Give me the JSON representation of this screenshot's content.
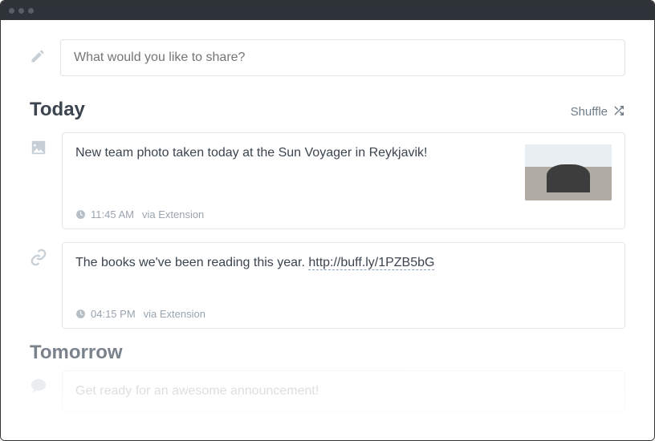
{
  "composer": {
    "placeholder": "What would you like to share?"
  },
  "shuffle_label": "Shuffle",
  "sections": {
    "today": {
      "title": "Today"
    },
    "tomorrow": {
      "title": "Tomorrow"
    }
  },
  "posts": {
    "p1": {
      "text": "New team photo taken today at the Sun Voyager in Reykjavik!",
      "time": "11:45 AM",
      "source": "via Extension"
    },
    "p2": {
      "text_prefix": "The books we've been reading this year. ",
      "link": "http://buff.ly/1PZB5bG",
      "time": "04:15 PM",
      "source": "via Extension"
    },
    "p3": {
      "text": "Get ready for an awesome announcement!"
    }
  }
}
